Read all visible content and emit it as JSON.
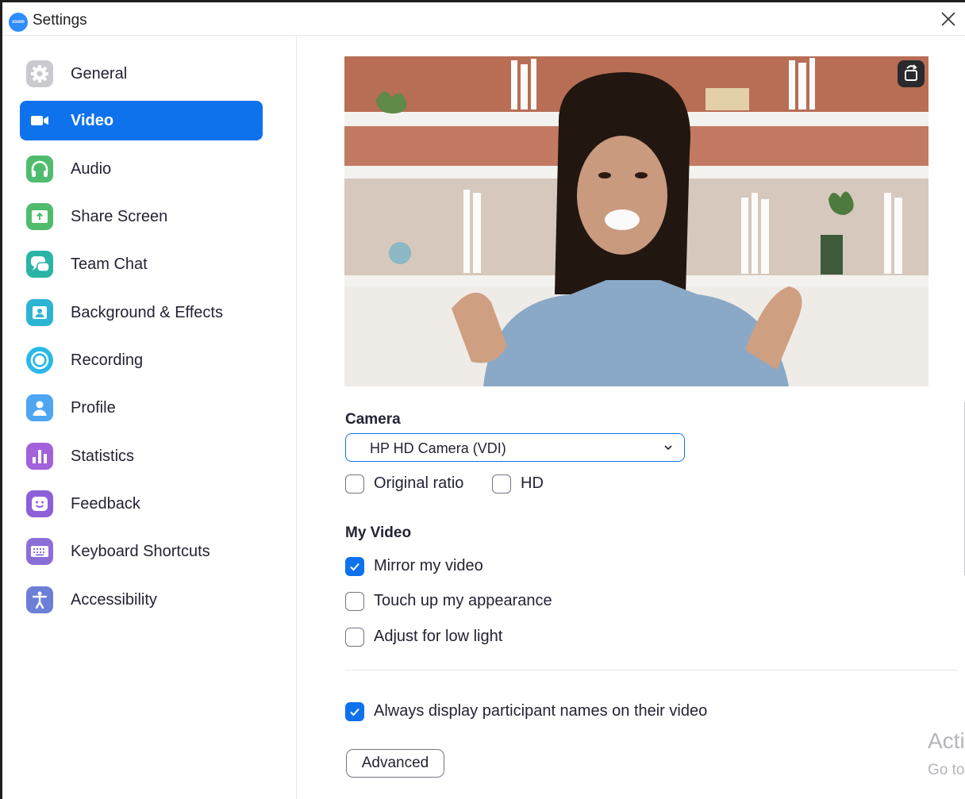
{
  "window": {
    "title": "Settings",
    "logo_text": "zoom"
  },
  "sidebar": {
    "items": [
      {
        "label": "General",
        "icon": "gear-icon",
        "color": "#c9c9cf",
        "active": false
      },
      {
        "label": "Video",
        "icon": "video-camera-icon",
        "color": "#0e72ed",
        "active": true
      },
      {
        "label": "Audio",
        "icon": "headphones-icon",
        "color": "#4fbc6d",
        "active": false
      },
      {
        "label": "Share Screen",
        "icon": "share-screen-icon",
        "color": "#4fbc6d",
        "active": false
      },
      {
        "label": "Team Chat",
        "icon": "chat-bubbles-icon",
        "color": "#2bb3a7",
        "active": false
      },
      {
        "label": "Background & Effects",
        "icon": "background-person-icon",
        "color": "#2cb5d2",
        "active": false
      },
      {
        "label": "Recording",
        "icon": "record-icon",
        "color": "#2ab8e8",
        "active": false
      },
      {
        "label": "Profile",
        "icon": "person-icon",
        "color": "#4ea6f2",
        "active": false
      },
      {
        "label": "Statistics",
        "icon": "bar-chart-icon",
        "color": "#a361dc",
        "active": false
      },
      {
        "label": "Feedback",
        "icon": "smiley-icon",
        "color": "#8d5fd9",
        "active": false
      },
      {
        "label": "Keyboard Shortcuts",
        "icon": "keyboard-icon",
        "color": "#8b6fd9",
        "active": false
      },
      {
        "label": "Accessibility",
        "icon": "accessibility-icon",
        "color": "#6c7fd6",
        "active": false
      }
    ]
  },
  "main": {
    "camera": {
      "heading": "Camera",
      "selected": "HP HD Camera (VDI)",
      "options": [
        {
          "label": "Original ratio",
          "checked": false
        },
        {
          "label": "HD",
          "checked": false
        }
      ]
    },
    "my_video": {
      "heading": "My Video",
      "options": [
        {
          "label": "Mirror my video",
          "checked": true
        },
        {
          "label": "Touch up my appearance",
          "checked": false
        },
        {
          "label": "Adjust for low light",
          "checked": false
        }
      ]
    },
    "participant_names": {
      "label": "Always display participant names on their video",
      "checked": true
    },
    "advanced_label": "Advanced"
  },
  "watermark": {
    "line1": "Acti",
    "line2": "Go to"
  },
  "colors": {
    "accent": "#0e72ed",
    "sidebar_active_text": "#ffffff"
  }
}
